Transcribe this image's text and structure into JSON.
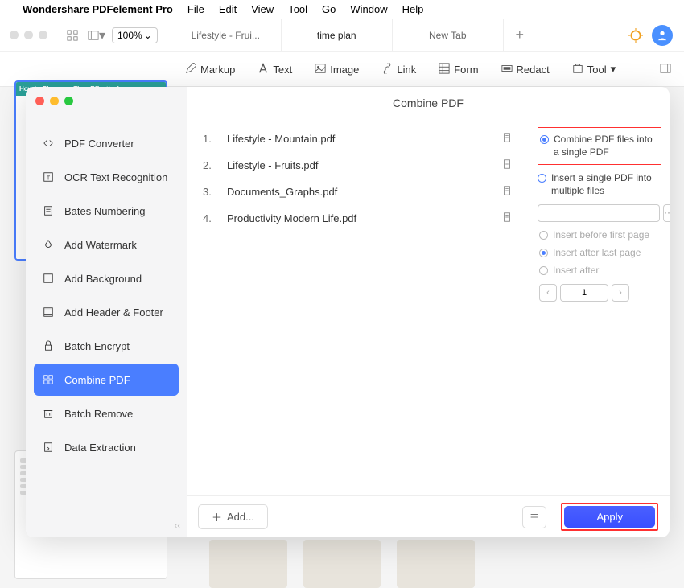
{
  "menubar": {
    "appname": "Wondershare PDFelement Pro",
    "items": [
      "File",
      "Edit",
      "View",
      "Tool",
      "Go",
      "Window",
      "Help"
    ]
  },
  "toprow": {
    "zoom": "100%",
    "tabs": [
      "Lifestyle - Frui...",
      "time plan",
      "New Tab"
    ]
  },
  "toolbar2": {
    "markup": "Markup",
    "text": "Text",
    "image": "Image",
    "link": "Link",
    "form": "Form",
    "redact": "Redact",
    "tool": "Tool"
  },
  "thumb_banner": "How to Plan your Time Effectively",
  "dialog": {
    "title": "Combine PDF",
    "nav": [
      "PDF Converter",
      "OCR Text Recognition",
      "Bates Numbering",
      "Add Watermark",
      "Add Background",
      "Add Header & Footer",
      "Batch Encrypt",
      "Combine PDF",
      "Batch Remove",
      "Data Extraction"
    ],
    "files": [
      {
        "n": "1.",
        "name": "Lifestyle - Mountain.pdf"
      },
      {
        "n": "2.",
        "name": "Lifestyle - Fruits.pdf"
      },
      {
        "n": "3.",
        "name": "Documents_Graphs.pdf"
      },
      {
        "n": "4.",
        "name": "Productivity Modern Life.pdf"
      }
    ],
    "opts": {
      "combine": "Combine PDF files into a single PDF",
      "insert": "Insert a single PDF into multiple files",
      "before": "Insert before first page",
      "after": "Insert after last page",
      "afterp": "Insert after",
      "page": "1"
    },
    "add": "Add...",
    "apply": "Apply"
  }
}
